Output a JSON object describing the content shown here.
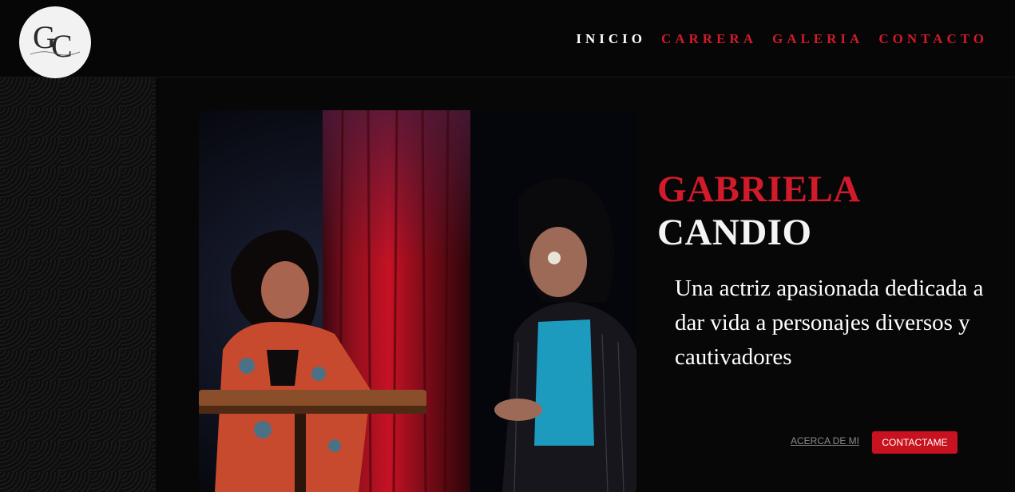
{
  "header": {
    "logo_monogram": "GC",
    "logo_signature": "Gabriela Candio",
    "nav": [
      {
        "label": "INICIO",
        "active": true
      },
      {
        "label": "CARRERA",
        "active": false
      },
      {
        "label": "GALERIA",
        "active": false
      },
      {
        "label": "CONTACTO",
        "active": false
      }
    ]
  },
  "hero": {
    "first_name": "GABRIELA",
    "last_name": "CANDIO",
    "tagline": "Una actriz apasionada dedicada a dar vida a personajes diversos y cautivadores",
    "about_button": "ACERCA DE MI",
    "contact_button": "CONTACTAME",
    "photo": "two-actresses-seated-at-table-red-curtain"
  },
  "colors": {
    "accent": "#d11a2a",
    "background": "#0b0b0b",
    "text": "#ffffff"
  }
}
